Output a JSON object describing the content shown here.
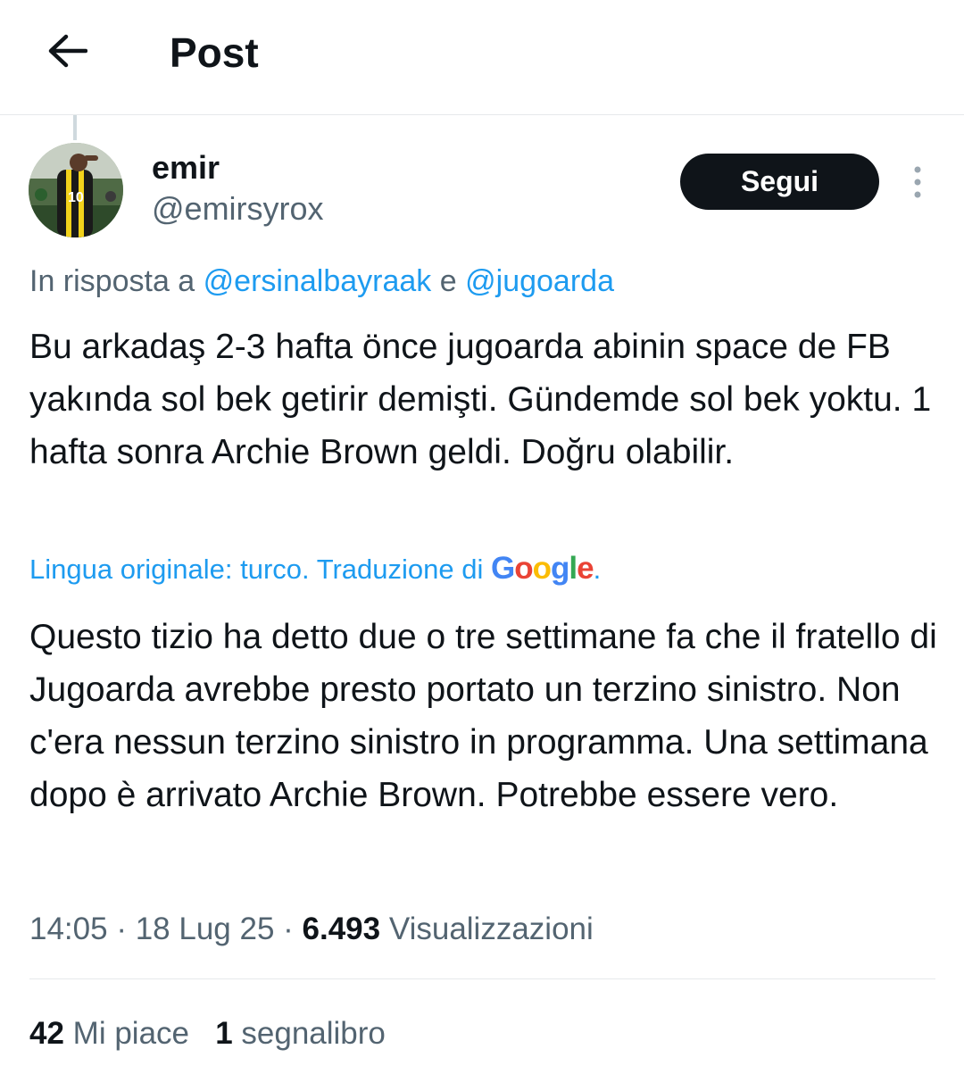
{
  "header": {
    "title": "Post",
    "back_icon": "arrow-left-icon"
  },
  "post": {
    "author_name": "emir",
    "author_handle": "@emirsyrox",
    "follow_label": "Segui",
    "more_icon": "more-vertical-icon",
    "reply_prefix": "In risposta a",
    "reply_handle_1": "@ersinalbayraak",
    "reply_conj": "e",
    "reply_handle_2": "@jugoarda",
    "original_text": "Bu arkadaş 2-3 hafta önce jugoarda abinin space de FB yakında sol bek getirir demişti. Gündemde sol bek yoktu. 1 hafta sonra Archie Brown geldi. Doğru olabilir.",
    "translation_note": "Lingua originale: turco. Traduzione di",
    "translation_provider": "Google",
    "translation_suffix": ".",
    "translated_text": "Questo tizio ha detto due o tre settimane fa che il fratello di Jugoarda avrebbe presto portato un terzino sinistro. Non c'era nessun terzino sinistro in programma. Una settimana dopo è arrivato Archie Brown. Potrebbe essere vero.",
    "time": "14:05",
    "date": "18 Lug 25",
    "views_count": "6.493",
    "views_label": "Visualizzazioni",
    "likes_count": "42",
    "likes_label": "Mi piace",
    "bookmarks_count": "1",
    "bookmarks_label": "segnalibro"
  },
  "colors": {
    "accent": "#1d9bf0",
    "text": "#0f1419",
    "muted": "#536471",
    "border": "#e6e9eb"
  }
}
